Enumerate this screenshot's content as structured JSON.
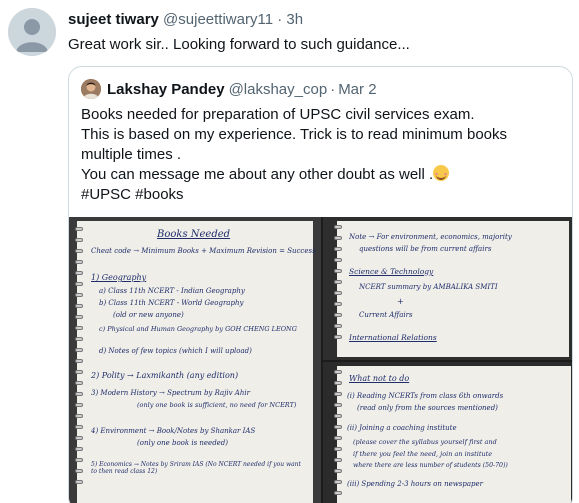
{
  "tweet": {
    "author_name": "sujeet tiwary",
    "author_handle": "@sujeettiwary11",
    "separator": "·",
    "time": "3h",
    "text": "Great work sir.. Looking forward to such guidance..."
  },
  "quoted_tweet": {
    "author_name": "Lakshay Pandey",
    "author_handle": "@lakshay_cop",
    "separator": "·",
    "date": "Mar 2",
    "lines": [
      "Books needed for preparation of UPSC civil services exam.",
      "This is based on my experience. Trick is to read minimum books multiple times .",
      "You can message me about any other doubt as well ."
    ],
    "hashtags": "#UPSC #books",
    "emoji": "smiling-face-icon"
  },
  "photos": {
    "photo1": {
      "heading": "Books Needed",
      "line1": "Cheat code → Minimum Books + Maximum Revision = Success",
      "line2": "1) Geography",
      "line3": "a) Class 11th NCERT - Indian Geography",
      "line4": "b) Class 11th NCERT - World Geography",
      "line5": "(old or new anyone)",
      "line6": "c) Physical and Human Geography by GOH CHENG LEONG",
      "line7": "d) Notes of few topics (which I will upload)",
      "line8": "2) Polity → Laxmikanth (any edition)",
      "line9": "3) Modern History → Spectrum by Rajiv Ahir",
      "line10": "(only one book is sufficient, no need for NCERT)",
      "line11": "4) Environment → Book/Notes by Shankar IAS",
      "line12": "(only one book is needed)",
      "line13": "5) Economics → Notes by Sriram IAS (No NCERT needed if you want to then read class 12)"
    },
    "photo2": {
      "line1": "Note → For environment, economics, majority",
      "line2": "questions will be from current affairs",
      "line3": "Science & Technology",
      "line4": "NCERT summary by AMBALIKA SMITI",
      "line5": "+",
      "line6": "Current Affairs",
      "line7": "International Relations"
    },
    "photo3": {
      "heading": "What not to do",
      "line1": "(i) Reading NCERTs from class 6th onwards",
      "line2": "(read only from the sources mentioned)",
      "line3": "(ii) Joining a coaching institute",
      "line4": "(please cover the syllabus yourself first and",
      "line5": "if there you feel the need, join an institute",
      "line6": "where there are less number of students (50-70))",
      "line7": "(iii) Spending 2-3 hours on newspaper"
    }
  }
}
